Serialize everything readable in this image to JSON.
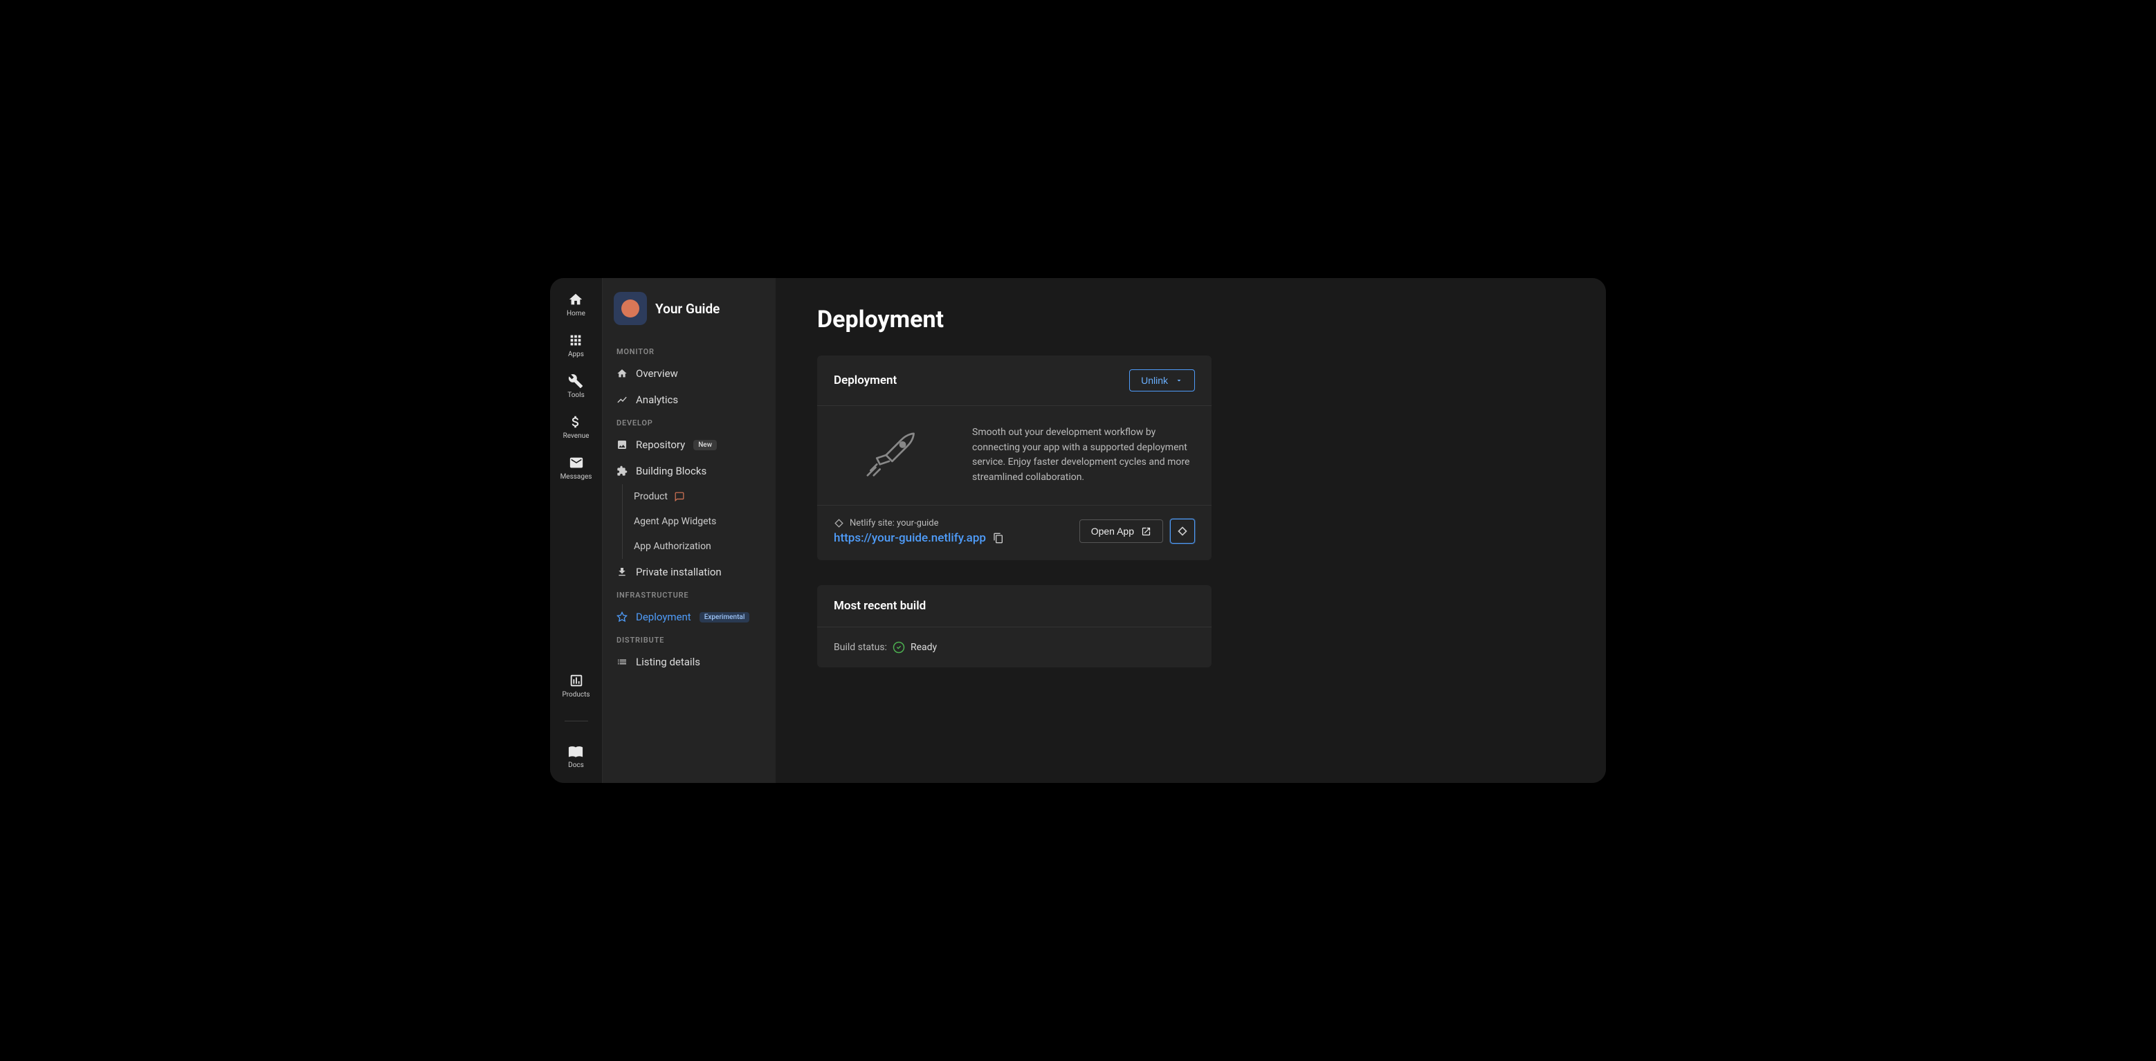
{
  "rail": {
    "top": [
      {
        "label": "Home"
      },
      {
        "label": "Apps"
      },
      {
        "label": "Tools"
      },
      {
        "label": "Revenue"
      },
      {
        "label": "Messages"
      }
    ],
    "bottom": [
      {
        "label": "Products"
      },
      {
        "label": "Docs"
      }
    ]
  },
  "sidebar": {
    "app_title": "Your Guide",
    "sections": {
      "monitor": "MONITOR",
      "develop": "DEVELOP",
      "infrastructure": "INFRASTRUCTURE",
      "distribute": "DISTRIBUTE"
    },
    "items": {
      "overview": "Overview",
      "analytics": "Analytics",
      "repository": "Repository",
      "repository_badge": "New",
      "building_blocks": "Building Blocks",
      "product": "Product",
      "agent_widgets": "Agent App Widgets",
      "app_auth": "App Authorization",
      "private_install": "Private installation",
      "deployment": "Deployment",
      "deployment_badge": "Experimental",
      "listing_details": "Listing details"
    }
  },
  "main": {
    "page_title": "Deployment",
    "card1": {
      "title": "Deployment",
      "unlink": "Unlink",
      "description": "Smooth out your development workflow by connecting your app with a supported deployment service. Enjoy faster development cycles and more streamlined collaboration.",
      "site_label": "Netlify site: your-guide",
      "site_url": "https://your-guide.netlify.app",
      "open_app": "Open App"
    },
    "card2": {
      "title": "Most recent build",
      "build_status_label": "Build status:",
      "build_status_value": "Ready"
    }
  }
}
